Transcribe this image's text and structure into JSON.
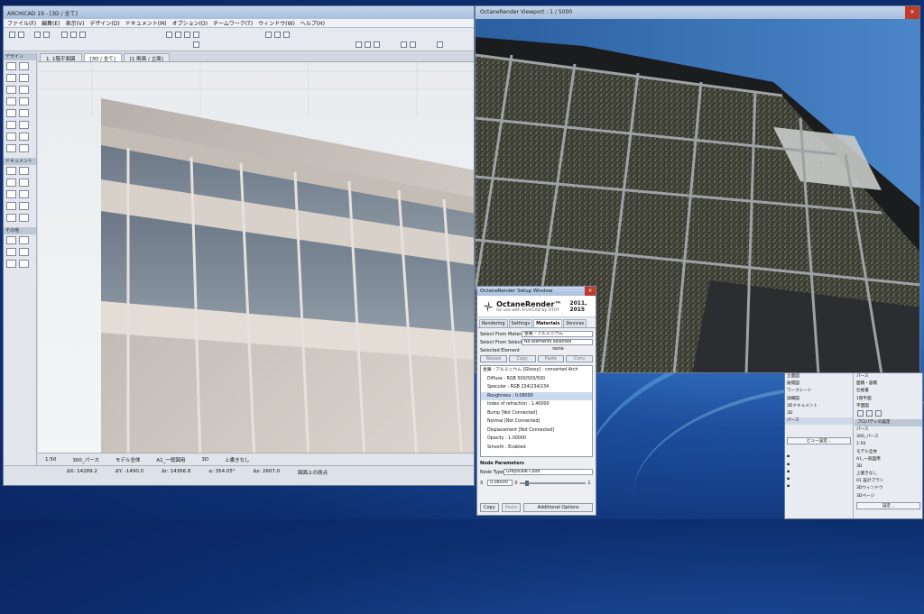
{
  "archicad": {
    "title": "ARCHICAD 19 - [3D / 全て]",
    "menu": [
      "ファイル(F)",
      "編集(E)",
      "表示(V)",
      "デザイン(D)",
      "ドキュメント(M)",
      "オプション(O)",
      "チームワーク(T)",
      "ウィンドウ(W)",
      "ヘルプ(H)"
    ],
    "tabs": [
      "1. 1階平面図",
      "[3D / 全て]",
      "[1 断面 / 立面]"
    ],
    "toolbox_sections": [
      "デザイン",
      "ドキュメント",
      "その他"
    ],
    "status_items": [
      "1:50",
      "300_パース",
      "モデル全体",
      "A1_一般図用",
      "3D",
      "上書きなし"
    ],
    "coords": [
      "ΔX: 14289.2",
      "ΔY: -1490.0",
      "Δr: 14366.8",
      "α: 354.05°",
      "Δz: 2607.0",
      "図面上の原点"
    ]
  },
  "octane_viewport": {
    "title": "OctaneRender Viewport : 1 / 5000"
  },
  "setup_window": {
    "title": "OctaneRender Setup Window",
    "logo_name": "OctaneRender™",
    "logo_sub": "for use with ArchiCAD\nby OTOY",
    "logo_year": "2011, 2015",
    "tabs": [
      "Rendering",
      "Settings",
      "Materials",
      "Devices"
    ],
    "select_from_material_label": "Select From Materi",
    "select_from_material_value": "金属 - アルミニウム",
    "select_from_select_label": "Select From Select",
    "select_from_select_value": "No elements selected",
    "selected_element_label": "Selected Element",
    "selected_element_value": "None",
    "buttons": [
      "Reload",
      "Copy",
      "Paste",
      "Conv"
    ],
    "tree": [
      {
        "text": "金属 - アルミニウム [Glossy] - converted Arch",
        "type": "root"
      },
      {
        "text": "Diffuse : RGB 500/500/500"
      },
      {
        "text": "Specular : RGB 234/234/234"
      },
      {
        "text": "Roughness : 0.08000",
        "type": "sel"
      },
      {
        "text": "Index of refraction : 1.40000"
      },
      {
        "text": "Bump [Not Connected]"
      },
      {
        "text": "Normal [Not Connected]"
      },
      {
        "text": "Displacement [Not Connected]"
      },
      {
        "text": "Opacity : 1.00000"
      },
      {
        "text": "Smooth : Enabled"
      }
    ],
    "node_params_label": "Node Parameters",
    "node_type_label": "Node Type",
    "node_type_value": "Greyscale Color",
    "x_label": "X",
    "x_value": "0.08000",
    "slider_min": "0",
    "slider_max": "1",
    "slider_fraction": 0.08,
    "bottom_buttons": [
      "Copy",
      "Paste",
      "Additional Options"
    ]
  },
  "palette": {
    "left_items": [
      "立面図",
      "展開図",
      "ワークシート",
      "詳細図",
      "3Dドキュメント",
      "3D",
      "パース"
    ],
    "right_items": [
      "パース",
      "面積・容積",
      "仕様書",
      "1階平面",
      "平面図"
    ],
    "view_settings_button": "ビュー設定...",
    "properties_title": "プロパティの設定",
    "settings_rows": [
      "パース",
      "300_パース",
      "1:50",
      "モデル全体",
      "A1_一般図用",
      "3D",
      "上書きなし",
      "01 設計プラン",
      "3Dウィンドウ",
      "3Dページ"
    ],
    "settings_button": "設定..."
  }
}
